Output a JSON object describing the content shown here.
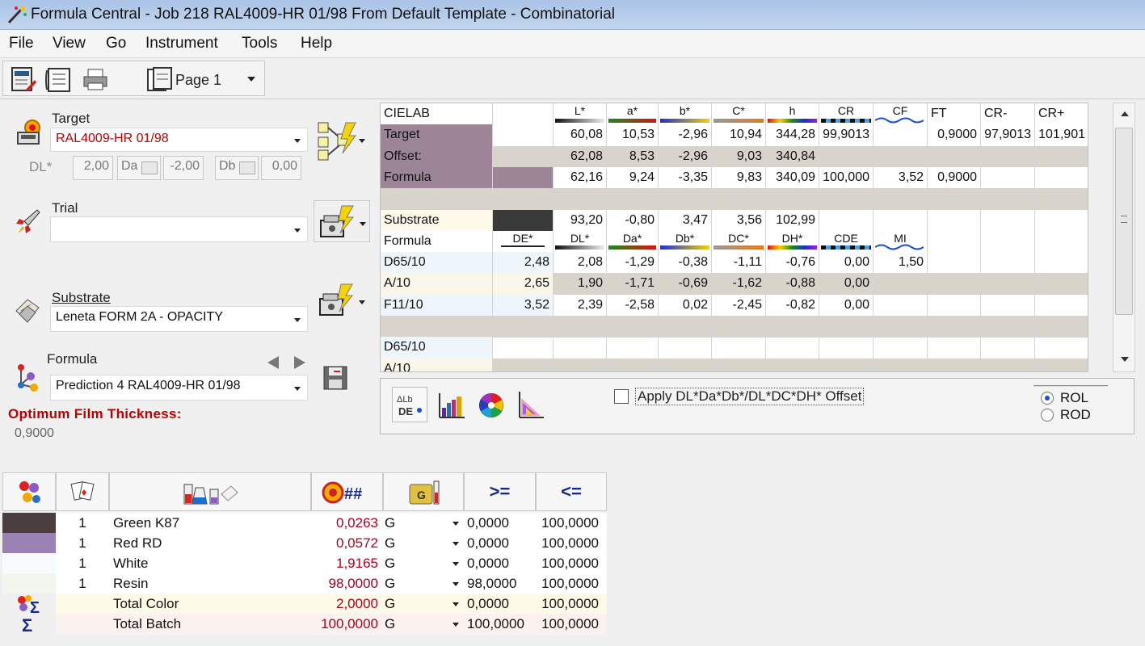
{
  "window": {
    "title": "Formula Central  -  Job 218 RAL4009-HR 01/98 From Default Template  -  Combinatorial"
  },
  "menu": [
    "File",
    "View",
    "Go",
    "Instrument",
    "Tools",
    "Help"
  ],
  "toolbar": {
    "page_label": "Page 1"
  },
  "left": {
    "target_label": "Target",
    "target_value": "RAL4009-HR 01/98",
    "dl_label": "DL*",
    "dl_value": "2,00",
    "da_label": "Da",
    "da_value": "-2,00",
    "db_label": "Db",
    "db_value": "0,00",
    "trial_label": "Trial",
    "trial_value": "",
    "substrate_label": "Substrate",
    "substrate_value": "Leneta FORM 2A - OPACITY",
    "formula_label": "Formula",
    "formula_value": "Prediction 4 RAL4009-HR 01/98",
    "oft_label": "Optimum Film Thickness:",
    "oft_value": "0,9000"
  },
  "grid": {
    "header": [
      "CIELAB",
      "",
      "L*",
      "a*",
      "b*",
      "C*",
      "h",
      "CR",
      "CF",
      "FT",
      "CR-",
      "CR+"
    ],
    "rows1": [
      [
        "Target",
        "",
        "60,08",
        "10,53",
        "-2,96",
        "10,94",
        "344,28",
        "99,9013",
        "",
        "0,9000",
        "97,9013",
        "101,901"
      ],
      [
        "Offset:",
        "",
        "62,08",
        "8,53",
        "-2,96",
        "9,03",
        "340,84",
        "",
        "",
        "",
        "",
        ""
      ],
      [
        "Formula",
        "",
        "62,16",
        "9,24",
        "-3,35",
        "9,83",
        "340,09",
        "100,000",
        "3,52",
        "0,9000",
        "",
        ""
      ]
    ],
    "substrate_row": [
      "Substrate",
      "",
      "93,20",
      "-0,80",
      "3,47",
      "3,56",
      "102,99",
      "",
      "",
      "",
      "",
      ""
    ],
    "header2": [
      "Formula",
      "DE*",
      "DL*",
      "Da*",
      "Db*",
      "DC*",
      "DH*",
      "CDE",
      "MI",
      "",
      "",
      ""
    ],
    "rows2": [
      [
        "D65/10",
        "2,48",
        "2,08",
        "-1,29",
        "-0,38",
        "-1,11",
        "-0,76",
        "0,00",
        "1,50",
        "",
        "",
        ""
      ],
      [
        "A/10",
        "2,65",
        "1,90",
        "-1,71",
        "-0,69",
        "-1,62",
        "-0,88",
        "0,00",
        "",
        "",
        "",
        ""
      ],
      [
        "F11/10",
        "3,52",
        "2,39",
        "-2,58",
        "0,02",
        "-2,45",
        "-0,82",
        "0,00",
        "",
        "",
        "",
        ""
      ]
    ],
    "rows3": [
      [
        "D65/10"
      ],
      [
        "A/10"
      ]
    ]
  },
  "panel": {
    "offset_label": "Apply DL*Da*Db*/DL*DC*DH* Offset",
    "rol": "ROL",
    "rod": "ROD"
  },
  "formula_table": {
    "rows": [
      {
        "color": "#4a3e3f",
        "qty": "1",
        "name": "Green K87",
        "amount": "0,0263",
        "unit": "G",
        "min": "0,0000",
        "max": "100,0000"
      },
      {
        "color": "#9b82b4",
        "qty": "1",
        "name": "Red RD",
        "amount": "0,0572",
        "unit": "G",
        "min": "0,0000",
        "max": "100,0000"
      },
      {
        "color": "#f7fbfd",
        "qty": "1",
        "name": "White",
        "amount": "1,9165",
        "unit": "G",
        "min": "0,0000",
        "max": "100,0000"
      },
      {
        "color": "#f1f7ef",
        "qty": "1",
        "name": "Resin",
        "amount": "98,0000",
        "unit": "G",
        "min": "98,0000",
        "max": "100,0000"
      }
    ],
    "totals": [
      {
        "name": "Total Color",
        "amount": "2,0000",
        "unit": "G",
        "min": "0,0000",
        "max": "100,0000"
      },
      {
        "name": "Total Batch",
        "amount": "100,0000",
        "unit": "G",
        "min": "100,0000",
        "max": "100,0000"
      }
    ],
    "header_ge": ">=",
    "header_le": "<="
  }
}
